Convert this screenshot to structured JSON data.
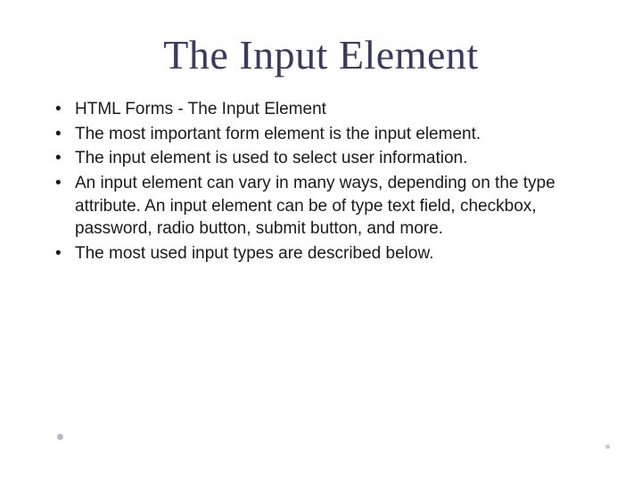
{
  "title": "The Input Element",
  "bullets": [
    "HTML Forms - The Input Element",
    "The most important form element is the input element.",
    "The input element is used to select user information.",
    "An input element can vary in many ways, depending on the type attribute. An input element can be of type text field, checkbox, password, radio button, submit button, and more.",
    "The most used input types are described below."
  ]
}
